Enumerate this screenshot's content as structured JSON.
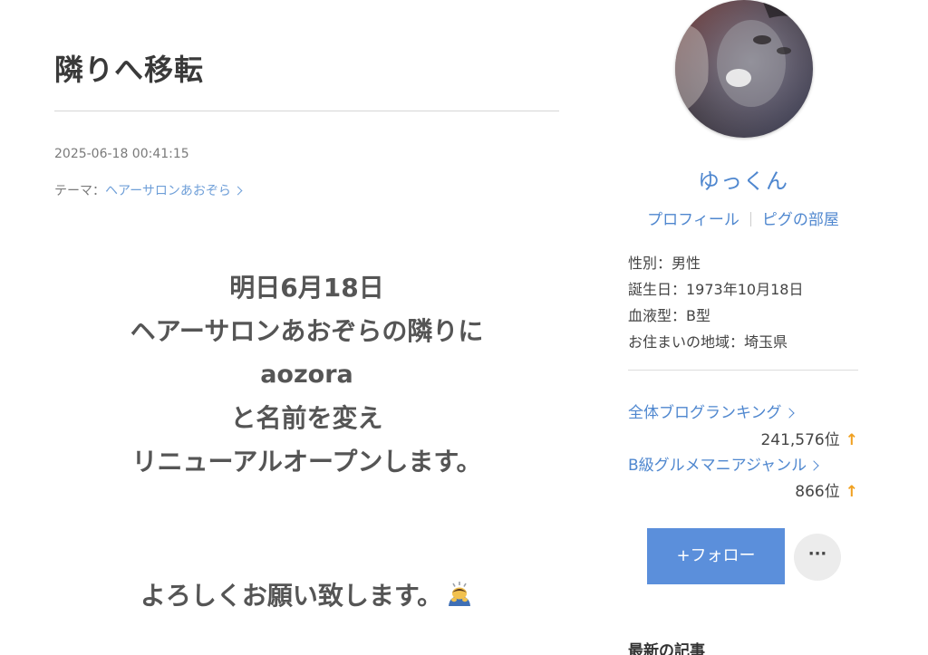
{
  "article": {
    "title": "隣りへ移転",
    "date": "2025-06-18 00:41:15",
    "theme_prefix": "テーマ：",
    "theme_link": "ヘアーサロンあおぞら",
    "body_lines": [
      "明日6月18日",
      "ヘアーサロンあおぞらの隣りに",
      "aozora",
      "と名前を変え",
      "リニューアルオープンします。"
    ],
    "closing": "よろしくお願い致します。",
    "closing_emoji": "bowing-person-emoji"
  },
  "sidebar": {
    "nickname": "ゆっくん",
    "profile_link": "プロフィール",
    "pigg_link": "ピグの部屋",
    "info": {
      "gender": "性別：男性",
      "birthday": "誕生日：1973年10月18日",
      "blood": "血液型：B型",
      "region": "お住まいの地域：埼玉県"
    },
    "rankings": [
      {
        "label": "全体ブログランキング",
        "value": "241,576位"
      },
      {
        "label": "B級グルメマニアジャンル",
        "value": "866位"
      }
    ],
    "up_arrow": "↑",
    "follow_label": "+フォロー",
    "more_label": "···",
    "latest_heading": "最新の記事"
  },
  "colors": {
    "accent": "#4f87cf",
    "follow_button": "#5b8fdb",
    "rank_up": "#f0a020"
  }
}
